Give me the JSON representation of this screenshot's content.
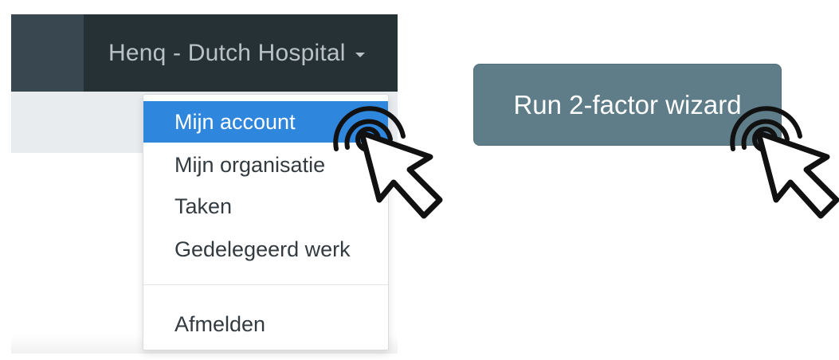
{
  "navbar": {
    "user_label": "Henq - Dutch Hospital",
    "caret_icon": "caret-down-icon"
  },
  "dropdown": {
    "items": [
      {
        "label": "Mijn account",
        "active": true
      },
      {
        "label": "Mijn organisatie",
        "active": false
      },
      {
        "label": "Taken",
        "active": false
      },
      {
        "label": "Gedelegeerd werk",
        "active": false
      }
    ],
    "logout_label": "Afmelden"
  },
  "wizard": {
    "button_label": "Run 2-factor wizard"
  },
  "cursor_icon": "click-hand-pointer-icon",
  "colors": {
    "navbar": "#2f3b42",
    "navbar_user": "#263136",
    "active_item": "#2f86dd",
    "wizard_button": "#5f7d88"
  }
}
